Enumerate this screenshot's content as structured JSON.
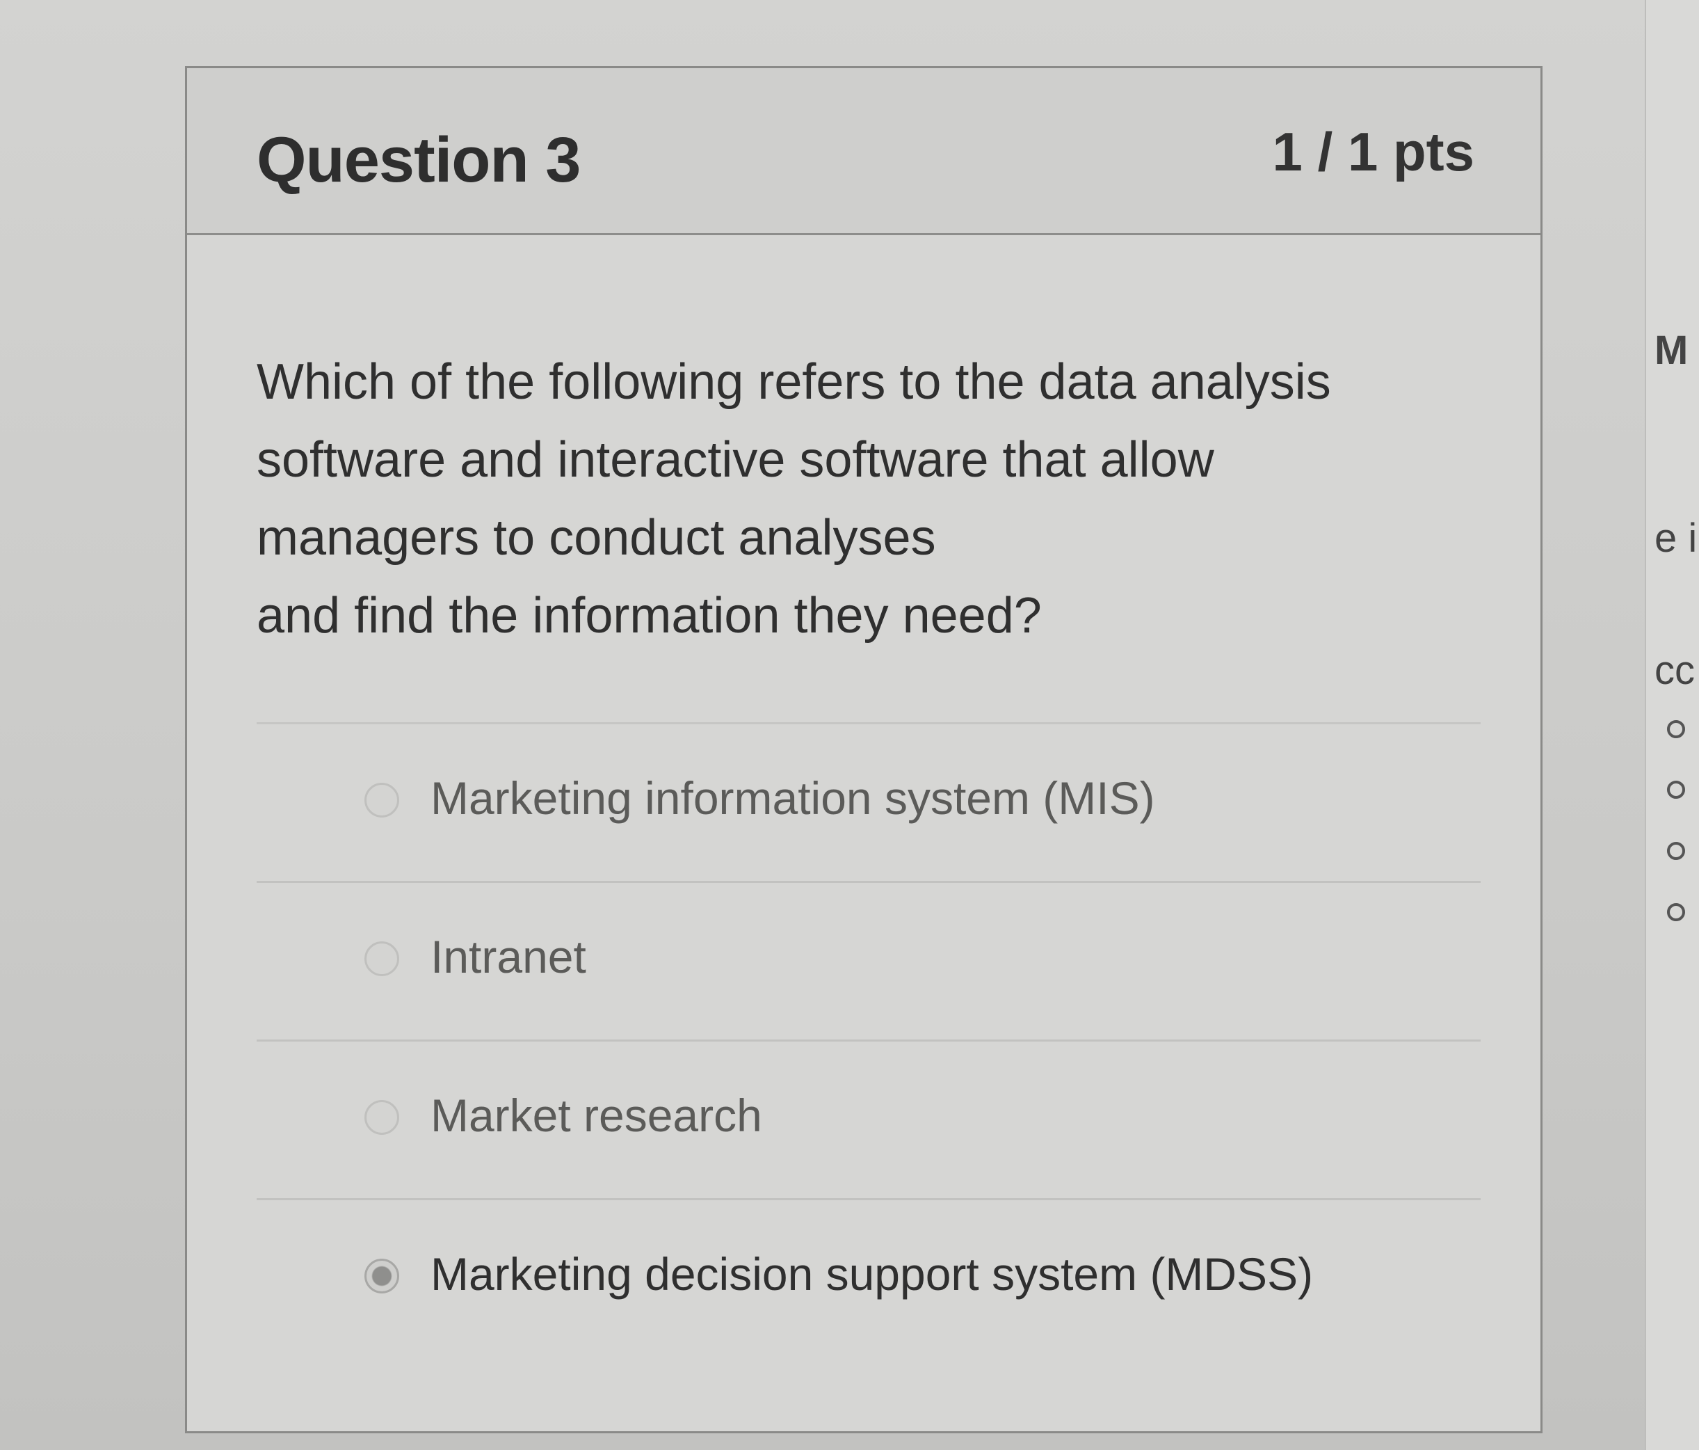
{
  "question": {
    "title": "Question 3",
    "points": "1 / 1 pts",
    "text_lines": [
      "Which of the following refers to the data analysis",
      "software and interactive software that allow",
      "managers to conduct analyses",
      "and find the information they need?"
    ]
  },
  "answers": [
    {
      "label": "Marketing information system (MIS)",
      "selected": false
    },
    {
      "label": "Intranet",
      "selected": false
    },
    {
      "label": "Market research",
      "selected": false
    },
    {
      "label": "Marketing decision support system (MDSS)",
      "selected": true
    }
  ],
  "side_panel": {
    "fragments": [
      "M",
      "e i",
      "cc"
    ]
  }
}
